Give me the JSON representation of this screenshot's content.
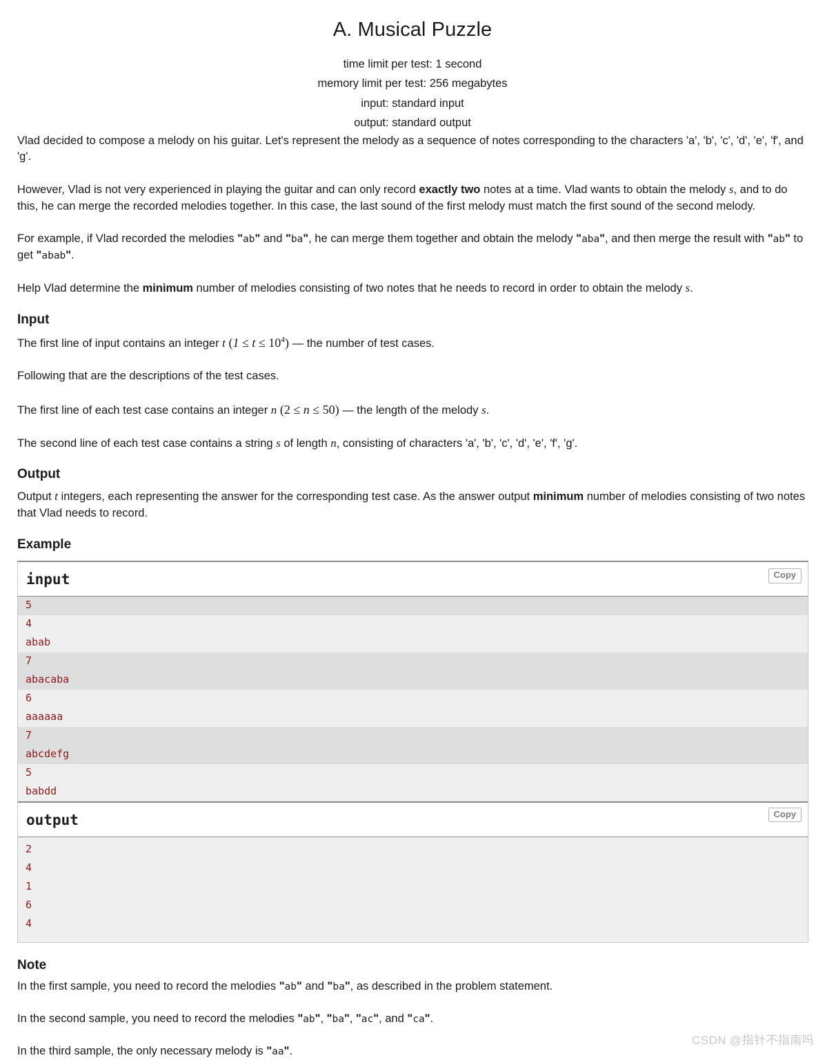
{
  "header": {
    "title": "A. Musical Puzzle",
    "limits": [
      "time limit per test: 1 second",
      "memory limit per test: 256 megabytes",
      "input: standard input",
      "output: standard output"
    ]
  },
  "statement": {
    "p1_a": "Vlad decided to compose a melody on his guitar. Let's represent the melody as a sequence of notes corresponding to the characters 'a', 'b', 'c', 'd', 'e', 'f', and 'g'.",
    "p2_a": "However, Vlad is not very experienced in playing the guitar and can only record ",
    "p2_bold": "exactly two",
    "p2_b": " notes at a time. Vlad wants to obtain the melody ",
    "p2_var1": "s",
    "p2_c": ", and to do this, he can merge the recorded melodies together. In this case, the last sound of the first melody must match the first sound of the second melody.",
    "p3_a": "For example, if Vlad recorded the melodies ",
    "p3_m1": "ab",
    "p3_b": " and ",
    "p3_m2": "ba",
    "p3_c": ", he can merge them together and obtain the melody ",
    "p3_m3": "aba",
    "p3_d": ", and then merge the result with ",
    "p3_m4": "ab",
    "p3_e": " to get ",
    "p3_m5": "abab",
    "p3_f": ".",
    "p4_a": "Help Vlad determine the ",
    "p4_bold": "minimum",
    "p4_b": " number of melodies consisting of two notes that he needs to record in order to obtain the melody ",
    "p4_var": "s",
    "p4_c": "."
  },
  "input_section": {
    "heading": "Input",
    "l1_a": "The first line of input contains an integer ",
    "l1_var": "t",
    "l1_math": "(1 ≤ t ≤ 10",
    "l1_exp": "4",
    "l1_math2": ")",
    "l1_b": " — the number of test cases.",
    "l2": "Following that are the descriptions of the test cases.",
    "l3_a": "The first line of each test case contains an integer ",
    "l3_var": "n",
    "l3_math": "(2 ≤ n ≤ 50)",
    "l3_b": " — the length of the melody ",
    "l3_var2": "s",
    "l3_c": ".",
    "l4_a": "The second line of each test case contains a string ",
    "l4_var": "s",
    "l4_b": " of length ",
    "l4_var2": "n",
    "l4_c": ", consisting of characters 'a', 'b', 'c', 'd', 'e', 'f', 'g'."
  },
  "output_section": {
    "heading": "Output",
    "l1_a": "Output ",
    "l1_var": "t",
    "l1_b": " integers, each representing the answer for the corresponding test case. As the answer output ",
    "l1_bold": "minimum",
    "l1_c": " number of melodies consisting of two notes that Vlad needs to record."
  },
  "example_section": {
    "heading": "Example",
    "input_label": "input",
    "output_label": "output",
    "copy_label": "Copy",
    "input_lines": [
      "5",
      "4",
      "abab",
      "7",
      "abacaba",
      "6",
      "aaaaaa",
      "7",
      "abcdefg",
      "5",
      "babdd"
    ],
    "input_stripes": [
      1,
      0,
      0,
      1,
      1,
      0,
      0,
      1,
      1,
      0,
      0
    ],
    "output_lines": [
      "2",
      "4",
      "1",
      "6",
      "4"
    ]
  },
  "note_section": {
    "heading": "Note",
    "n1_a": "In the first sample, you need to record the melodies ",
    "n1_m1": "ab",
    "n1_b": " and ",
    "n1_m2": "ba",
    "n1_c": ", as described in the problem statement.",
    "n2_a": "In the second sample, you need to record the melodies ",
    "n2_m1": "ab",
    "n2_b": ", ",
    "n2_m2": "ba",
    "n2_c": ", ",
    "n2_m3": "ac",
    "n2_d": ", and ",
    "n2_m4": "ca",
    "n2_e": ".",
    "n3_a": "In the third sample, the only necessary melody is ",
    "n3_m1": "aa",
    "n3_b": "."
  },
  "watermark": {
    "text": "CSDN @指针不指南吗"
  }
}
